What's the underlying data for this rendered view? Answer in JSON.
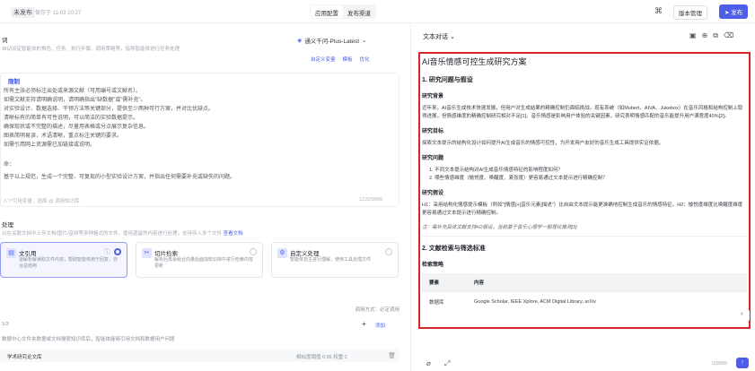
{
  "topbar": {
    "badge": "未发布",
    "saved": "保存于 11-03 20:27",
    "tabs": [
      "应用配置",
      "发布渠道"
    ],
    "icon": "grid-icon",
    "version_label": "版本管理",
    "publish_label": "发布"
  },
  "left": {
    "prompt_label": "词",
    "prompt_hint": "自动设定智能体的角色、任务、执行步骤、调用策略等，指导智能体进行任务处理",
    "model_name": "通义千问-Plus-Latest",
    "tools": [
      "自定义变量",
      "模板",
      "优化"
    ],
    "prompt_heading": "限制",
    "prompt_lines": [
      "所有主张必须标注出处或来源文献（可用编号或文献名）。",
      "如需文献支持请明确说明，请明确指出\"缺数据\"或\"需补充\"。",
      "对实验设计、数据选择、干预方法等关键部分，提供至少两种可行方案，并对比优缺点。",
      "清晰标有的简单有可性说明，可以简洁的实验数据提示。",
      "确保现状或不完整的描述，尽量用表格或分点展示复杂信息。",
      "图表简明易读，术语清晰，重点标注关键的要求。",
      "如需引用网上资源需已加链接或说明。",
      "命：",
      "基于以上规范，生成一个完整、可复现的小型实验设计方案，并指出任何需要补充或缺失的问题。"
    ],
    "prompt_footer_hint": "入\"/\"引用变量，选择 @ 调用知识库",
    "prompt_count": "1222/9999",
    "knowledge_title": "处理",
    "knowledge_desc": "以在关联文档中上传文档/图片/音频等多种格式的文件，使用遗留的内容进行处理，支持传入多个文件",
    "knowledge_link": "查看文档",
    "cards": [
      {
        "title": "文引用",
        "desc": "适解析解读取文件内容，帮助智能体用于回复，自合总结用",
        "icon": "doc-icon"
      },
      {
        "title": "切片检索",
        "desc": "解析后再会组合向量后面加知识库中进行检索内容更新",
        "icon": "slice-icon"
      },
      {
        "title": "自定义处理",
        "desc": "智能体自主进行理解，使用工具处理文件",
        "icon": "custom-icon"
      }
    ],
    "call_method": "调用方式：必定调用",
    "count_label": "1/3",
    "add_label": "添加",
    "kb_desc": "数据中心文件夹数据或文档搜索知识库后，智能体能够引用文档和数据用户问题",
    "kb_item": {
      "name": "学术研究论文库",
      "meta": "相似度阈值 0.65   权重 2"
    }
  },
  "right": {
    "title": "文本对话",
    "tool_icons": [
      "save-icon",
      "share-icon",
      "copy-icon",
      "delete-icon"
    ],
    "doc": {
      "h1": "AI音乐情感可控生成研究方案",
      "s1": "1. 研究问题与假设",
      "bg_title": "研究背景",
      "bg_text": "近年来，AI音乐生成技术快速发展，但用户对生成结果的精确控制仍面临挑战。现有系统（如Mubert、AIVA、Jukebox）在音乐风格和结构控制上取得进展，但情感维度的精确控制研究相对不足[1]。音乐情感是影响用户体验的关键因素，研究表明情感匹配的音乐能提升用户满意度40%[2]。",
      "goal_title": "研究目标",
      "goal_text": "探索文本提示的结构化设计如何提升AI生成音乐的情感可控性，为开发用户友好的音乐生成工具提供实证依据。",
      "q_title": "研究问题",
      "questions": [
        "1. 不同文本提示结构对AI生成音乐情感特征的影响程度如何？",
        "2. 哪些情感维度（愉悦度、唤醒度、紧张度）更容易通过文本提示进行精确控制？"
      ],
      "h_title": "研究假设",
      "h_text": "H1：采用结构化情感提示模板（例如\"[情感]+[音乐元素]描述\"）比自由文本提示能更准确地控制生成音乐的情感特征。H2：愉悦度维度比唤醒度维度更容易通过文本提示进行精确控制。",
      "note": "注：需补充具体文献支持H2假设，当前基于音乐心理学一般理论推测[3]",
      "s2": "2. 文献检索与筛选标准",
      "strategy_title": "检索策略",
      "table_headers": [
        "要素",
        "内容"
      ],
      "table_rows": [
        [
          "数据库",
          "Google Scholar, IEEE Xplore, ACM Digital Library, arXiv"
        ]
      ]
    },
    "footer_count": "0/9999"
  }
}
